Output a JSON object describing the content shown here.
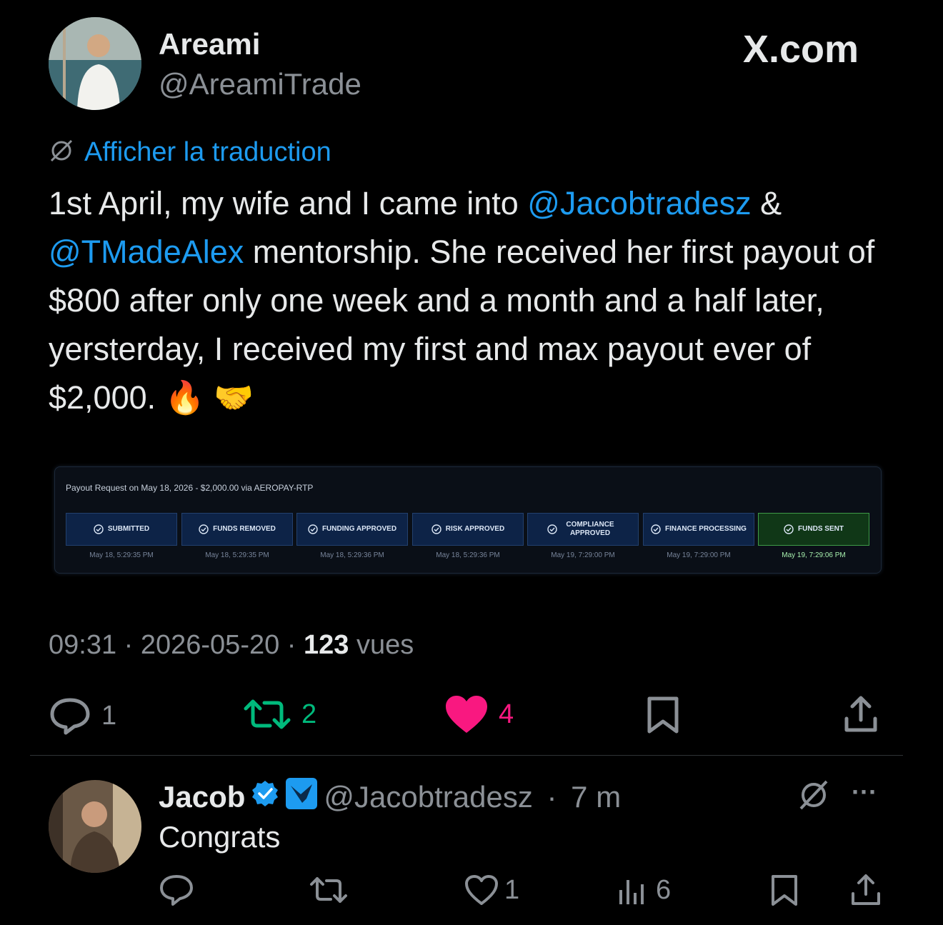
{
  "watermark": "X.com",
  "tweet": {
    "author_name": "Areami",
    "author_handle": "@AreamiTrade",
    "translate_label": "Afficher la traduction",
    "text_parts": {
      "p1": "1st April, my wife and I came into ",
      "mention1": "@Jacobtradesz",
      "p2": " & ",
      "mention2": "@TMadeAlex",
      "p3": " mentorship. She received her first payout of $800 after only one week and a month and a half later, yersterday, I received my first and max payout ever of $2,000.",
      "emoji": "🔥 🤝"
    },
    "timestamp": "09:31 · 2026-05-20 · ",
    "views_count": "123",
    "views_label": " vues",
    "actions": {
      "replies": "1",
      "retweets": "2",
      "likes": "4"
    }
  },
  "payout_card": {
    "title": "Payout Request on May 18, 2026 - $2,000.00 via AEROPAY-RTP",
    "steps": [
      {
        "label": "SUBMITTED",
        "time": "May 18, 5:29:35 PM"
      },
      {
        "label": "FUNDS REMOVED",
        "time": "May 18, 5:29:35 PM"
      },
      {
        "label": "FUNDING APPROVED",
        "time": "May 18, 5:29:36 PM"
      },
      {
        "label": "RISK APPROVED",
        "time": "May 18, 5:29:36 PM"
      },
      {
        "label": "COMPLIANCE APPROVED",
        "time": "May 19, 7:29:00 PM"
      },
      {
        "label": "FINANCE PROCESSING",
        "time": "May 19, 7:29:00 PM"
      },
      {
        "label": "FUNDS SENT",
        "time": "May 19, 7:29:06 PM"
      }
    ]
  },
  "reply": {
    "author_name": "Jacob",
    "author_handle": "@Jacobtradesz",
    "separator": " · ",
    "time_ago": "7 m",
    "text": "Congrats",
    "actions": {
      "likes": "1",
      "views": "6"
    },
    "more_label": "···"
  },
  "colors": {
    "link": "#1d9bf0",
    "retweet_green": "#00ba7c",
    "like_pink": "#f91880",
    "funds_sent_green": "#3f9b48"
  }
}
